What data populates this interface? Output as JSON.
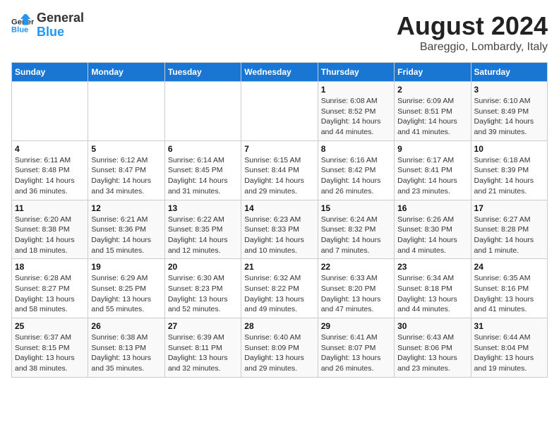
{
  "logo": {
    "line1": "General",
    "line2": "Blue"
  },
  "title": "August 2024",
  "subtitle": "Bareggio, Lombardy, Italy",
  "header": {
    "days": [
      "Sunday",
      "Monday",
      "Tuesday",
      "Wednesday",
      "Thursday",
      "Friday",
      "Saturday"
    ]
  },
  "weeks": [
    {
      "cells": [
        {
          "date": "",
          "info": ""
        },
        {
          "date": "",
          "info": ""
        },
        {
          "date": "",
          "info": ""
        },
        {
          "date": "",
          "info": ""
        },
        {
          "date": "1",
          "info": "Sunrise: 6:08 AM\nSunset: 8:52 PM\nDaylight: 14 hours and 44 minutes."
        },
        {
          "date": "2",
          "info": "Sunrise: 6:09 AM\nSunset: 8:51 PM\nDaylight: 14 hours and 41 minutes."
        },
        {
          "date": "3",
          "info": "Sunrise: 6:10 AM\nSunset: 8:49 PM\nDaylight: 14 hours and 39 minutes."
        }
      ]
    },
    {
      "cells": [
        {
          "date": "4",
          "info": "Sunrise: 6:11 AM\nSunset: 8:48 PM\nDaylight: 14 hours and 36 minutes."
        },
        {
          "date": "5",
          "info": "Sunrise: 6:12 AM\nSunset: 8:47 PM\nDaylight: 14 hours and 34 minutes."
        },
        {
          "date": "6",
          "info": "Sunrise: 6:14 AM\nSunset: 8:45 PM\nDaylight: 14 hours and 31 minutes."
        },
        {
          "date": "7",
          "info": "Sunrise: 6:15 AM\nSunset: 8:44 PM\nDaylight: 14 hours and 29 minutes."
        },
        {
          "date": "8",
          "info": "Sunrise: 6:16 AM\nSunset: 8:42 PM\nDaylight: 14 hours and 26 minutes."
        },
        {
          "date": "9",
          "info": "Sunrise: 6:17 AM\nSunset: 8:41 PM\nDaylight: 14 hours and 23 minutes."
        },
        {
          "date": "10",
          "info": "Sunrise: 6:18 AM\nSunset: 8:39 PM\nDaylight: 14 hours and 21 minutes."
        }
      ]
    },
    {
      "cells": [
        {
          "date": "11",
          "info": "Sunrise: 6:20 AM\nSunset: 8:38 PM\nDaylight: 14 hours and 18 minutes."
        },
        {
          "date": "12",
          "info": "Sunrise: 6:21 AM\nSunset: 8:36 PM\nDaylight: 14 hours and 15 minutes."
        },
        {
          "date": "13",
          "info": "Sunrise: 6:22 AM\nSunset: 8:35 PM\nDaylight: 14 hours and 12 minutes."
        },
        {
          "date": "14",
          "info": "Sunrise: 6:23 AM\nSunset: 8:33 PM\nDaylight: 14 hours and 10 minutes."
        },
        {
          "date": "15",
          "info": "Sunrise: 6:24 AM\nSunset: 8:32 PM\nDaylight: 14 hours and 7 minutes."
        },
        {
          "date": "16",
          "info": "Sunrise: 6:26 AM\nSunset: 8:30 PM\nDaylight: 14 hours and 4 minutes."
        },
        {
          "date": "17",
          "info": "Sunrise: 6:27 AM\nSunset: 8:28 PM\nDaylight: 14 hours and 1 minute."
        }
      ]
    },
    {
      "cells": [
        {
          "date": "18",
          "info": "Sunrise: 6:28 AM\nSunset: 8:27 PM\nDaylight: 13 hours and 58 minutes."
        },
        {
          "date": "19",
          "info": "Sunrise: 6:29 AM\nSunset: 8:25 PM\nDaylight: 13 hours and 55 minutes."
        },
        {
          "date": "20",
          "info": "Sunrise: 6:30 AM\nSunset: 8:23 PM\nDaylight: 13 hours and 52 minutes."
        },
        {
          "date": "21",
          "info": "Sunrise: 6:32 AM\nSunset: 8:22 PM\nDaylight: 13 hours and 49 minutes."
        },
        {
          "date": "22",
          "info": "Sunrise: 6:33 AM\nSunset: 8:20 PM\nDaylight: 13 hours and 47 minutes."
        },
        {
          "date": "23",
          "info": "Sunrise: 6:34 AM\nSunset: 8:18 PM\nDaylight: 13 hours and 44 minutes."
        },
        {
          "date": "24",
          "info": "Sunrise: 6:35 AM\nSunset: 8:16 PM\nDaylight: 13 hours and 41 minutes."
        }
      ]
    },
    {
      "cells": [
        {
          "date": "25",
          "info": "Sunrise: 6:37 AM\nSunset: 8:15 PM\nDaylight: 13 hours and 38 minutes."
        },
        {
          "date": "26",
          "info": "Sunrise: 6:38 AM\nSunset: 8:13 PM\nDaylight: 13 hours and 35 minutes."
        },
        {
          "date": "27",
          "info": "Sunrise: 6:39 AM\nSunset: 8:11 PM\nDaylight: 13 hours and 32 minutes."
        },
        {
          "date": "28",
          "info": "Sunrise: 6:40 AM\nSunset: 8:09 PM\nDaylight: 13 hours and 29 minutes."
        },
        {
          "date": "29",
          "info": "Sunrise: 6:41 AM\nSunset: 8:07 PM\nDaylight: 13 hours and 26 minutes."
        },
        {
          "date": "30",
          "info": "Sunrise: 6:43 AM\nSunset: 8:06 PM\nDaylight: 13 hours and 23 minutes."
        },
        {
          "date": "31",
          "info": "Sunrise: 6:44 AM\nSunset: 8:04 PM\nDaylight: 13 hours and 19 minutes."
        }
      ]
    }
  ]
}
